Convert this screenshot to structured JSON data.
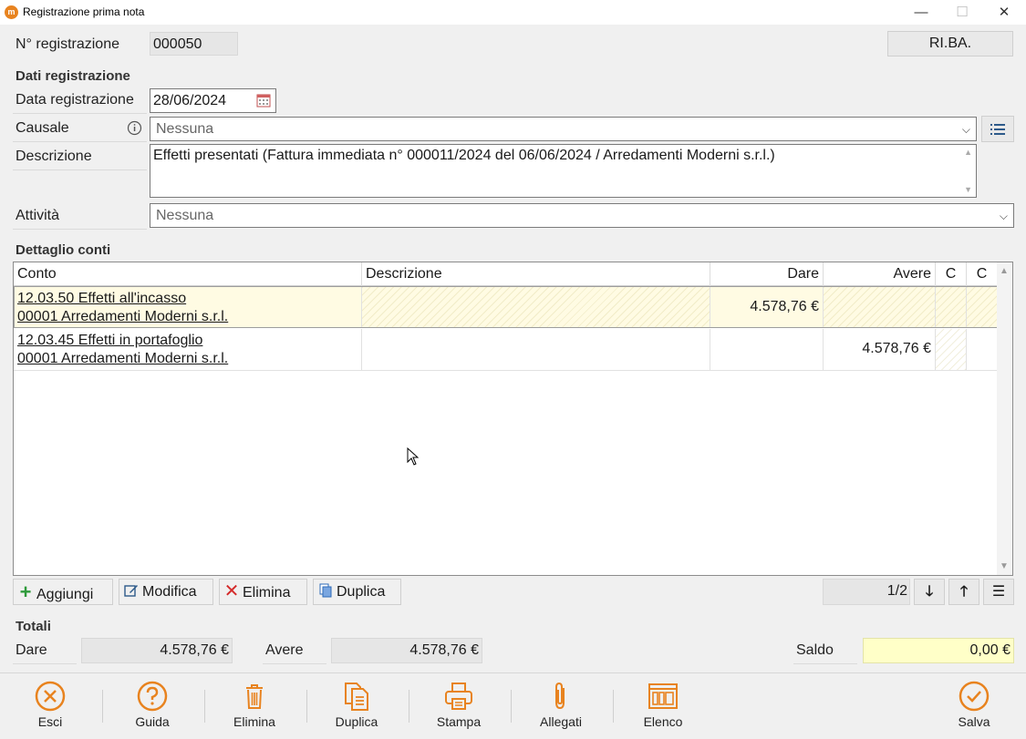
{
  "window": {
    "title": "Registrazione prima nota",
    "minimize": "—",
    "maximize": "☐",
    "close": "✕"
  },
  "header": {
    "num_label": "N° registrazione",
    "num_value": "000050",
    "type_button": "RI.BA."
  },
  "dati": {
    "section": "Dati registrazione",
    "data_label": "Data registrazione",
    "data_value": "28/06/2024",
    "causale_label": "Causale",
    "causale_value": "Nessuna",
    "descrizione_label": "Descrizione",
    "descrizione_value": "Effetti presentati (Fattura immediata n° 000011/2024 del 06/06/2024 / Arredamenti Moderni s.r.l.)",
    "attivita_label": "Attività",
    "attivita_value": "Nessuna"
  },
  "dettaglio": {
    "section": "Dettaglio conti",
    "columns": [
      "Conto",
      "Descrizione",
      "Dare",
      "Avere",
      "C",
      "C"
    ],
    "rows": [
      {
        "conto1": "12.03.50 Effetti all'incasso",
        "conto2": "00001 Arredamenti Moderni s.r.l.",
        "descrizione": "",
        "dare": "4.578,76 €",
        "avere": ""
      },
      {
        "conto1": "12.03.45 Effetti in portafoglio",
        "conto2": "00001 Arredamenti Moderni s.r.l.",
        "descrizione": "",
        "dare": "",
        "avere": "4.578,76 €"
      }
    ],
    "actions": {
      "add": "Aggiungi",
      "edit": "Modifica",
      "delete": "Elimina",
      "duplicate": "Duplica"
    },
    "pager": "1/2"
  },
  "totali": {
    "section": "Totali",
    "dare_label": "Dare",
    "dare_value": "4.578,76 €",
    "avere_label": "Avere",
    "avere_value": "4.578,76 €",
    "saldo_label": "Saldo",
    "saldo_value": "0,00 €"
  },
  "toolbar": {
    "esci": "Esci",
    "guida": "Guida",
    "elimina": "Elimina",
    "duplica": "Duplica",
    "stampa": "Stampa",
    "allegati": "Allegati",
    "elenco": "Elenco",
    "salva": "Salva"
  },
  "colors": {
    "accent": "#e8831f",
    "saldo_bg": "#ffffc8",
    "selected_row": "#fffbe3"
  }
}
